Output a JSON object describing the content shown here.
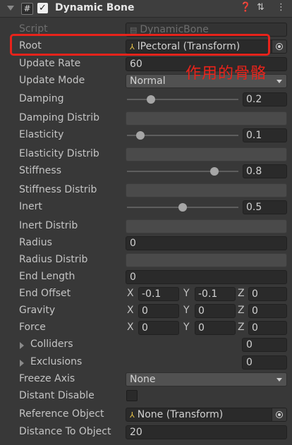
{
  "component": {
    "title": "Dynamic Bone",
    "help_icon": "help-icon",
    "presets_icon": "presets-icon",
    "menu_icon": "menu-icon",
    "enabled": true
  },
  "fields": {
    "script_label": "Script",
    "script_value": "DynamicBone",
    "root_label": "Root",
    "root_value": "lPectoral (Transform)",
    "update_rate_label": "Update Rate",
    "update_rate_value": "60",
    "update_mode_label": "Update Mode",
    "update_mode_value": "Normal",
    "damping_label": "Damping",
    "damping_value": "0.2",
    "damping_distrib_label": "Damping Distrib",
    "elasticity_label": "Elasticity",
    "elasticity_value": "0.1",
    "elasticity_distrib_label": "Elasticity Distrib",
    "stiffness_label": "Stiffness",
    "stiffness_value": "0.8",
    "stiffness_distrib_label": "Stiffness Distrib",
    "inert_label": "Inert",
    "inert_value": "0.5",
    "inert_distrib_label": "Inert Distrib",
    "radius_label": "Radius",
    "radius_value": "0",
    "radius_distrib_label": "Radius Distrib",
    "end_length_label": "End Length",
    "end_length_value": "0",
    "end_offset_label": "End Offset",
    "end_offset": {
      "x": "-0.1",
      "y": "-0.1",
      "z": "0"
    },
    "gravity_label": "Gravity",
    "gravity": {
      "x": "0",
      "y": "0",
      "z": "0"
    },
    "force_label": "Force",
    "force": {
      "x": "0",
      "y": "0",
      "z": "0"
    },
    "colliders_label": "Colliders",
    "colliders_size": "0",
    "exclusions_label": "Exclusions",
    "exclusions_size": "0",
    "freeze_axis_label": "Freeze Axis",
    "freeze_axis_value": "None",
    "distant_disable_label": "Distant Disable",
    "reference_object_label": "Reference Object",
    "reference_object_value": "None (Transform)",
    "distance_to_object_label": "Distance To Object",
    "distance_to_object_value": "20"
  },
  "axis_labels": {
    "x": "X",
    "y": "Y",
    "z": "Z"
  },
  "annotation": {
    "text": "作用的骨骼",
    "color": "#e8231b"
  },
  "colors": {
    "background": "#383838",
    "field": "#2a2a2a",
    "text": "#c4c4c4"
  }
}
